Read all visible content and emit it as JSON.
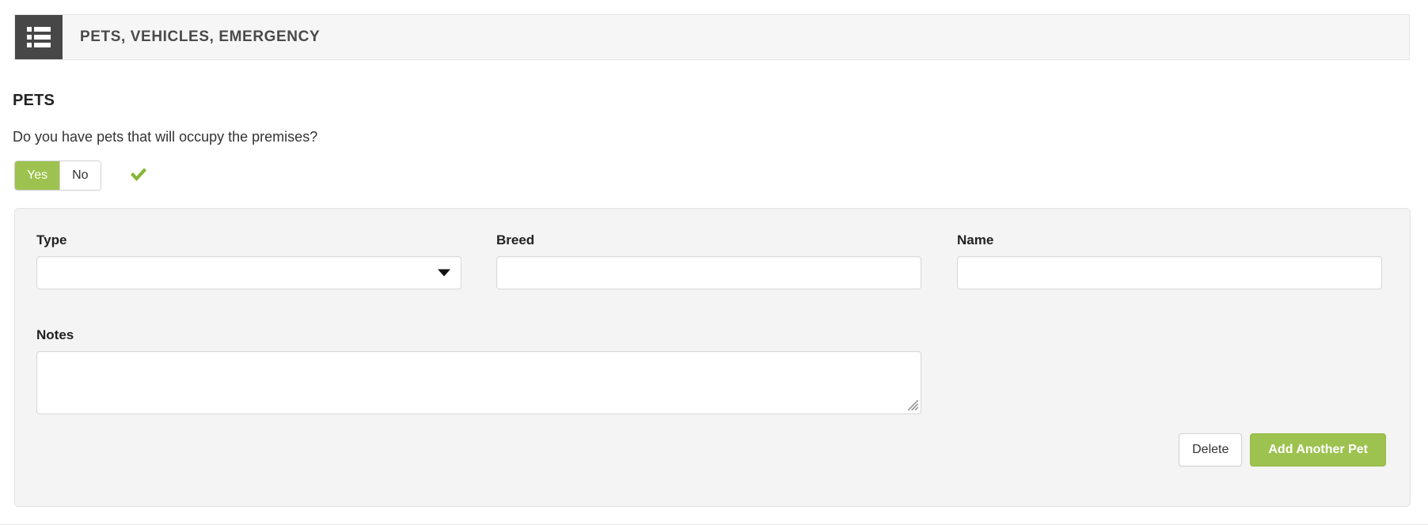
{
  "section": {
    "icon": "list-icon",
    "title": "PETS, VEHICLES, EMERGENCY"
  },
  "pets": {
    "heading": "PETS",
    "question": "Do you have pets that will occupy the premises?",
    "toggle": {
      "yes_label": "Yes",
      "no_label": "No",
      "selected": "Yes",
      "validation_icon": "check-icon"
    },
    "fields": {
      "type": {
        "label": "Type",
        "value": "",
        "placeholder": "",
        "control": "select",
        "icon": "chevron-down-icon"
      },
      "breed": {
        "label": "Breed",
        "value": "",
        "placeholder": "",
        "control": "text"
      },
      "name": {
        "label": "Name",
        "value": "",
        "placeholder": "",
        "control": "text"
      },
      "notes": {
        "label": "Notes",
        "value": "",
        "placeholder": "",
        "control": "textarea",
        "icon": "resize-grip-icon"
      }
    },
    "actions": {
      "delete_label": "Delete",
      "add_label": "Add Another Pet"
    }
  },
  "colors": {
    "accent_green": "#9DC24F",
    "header_icon_bg": "#474747",
    "header_bar_bg": "#f6f6f6",
    "panel_bg": "#f4f4f4"
  }
}
